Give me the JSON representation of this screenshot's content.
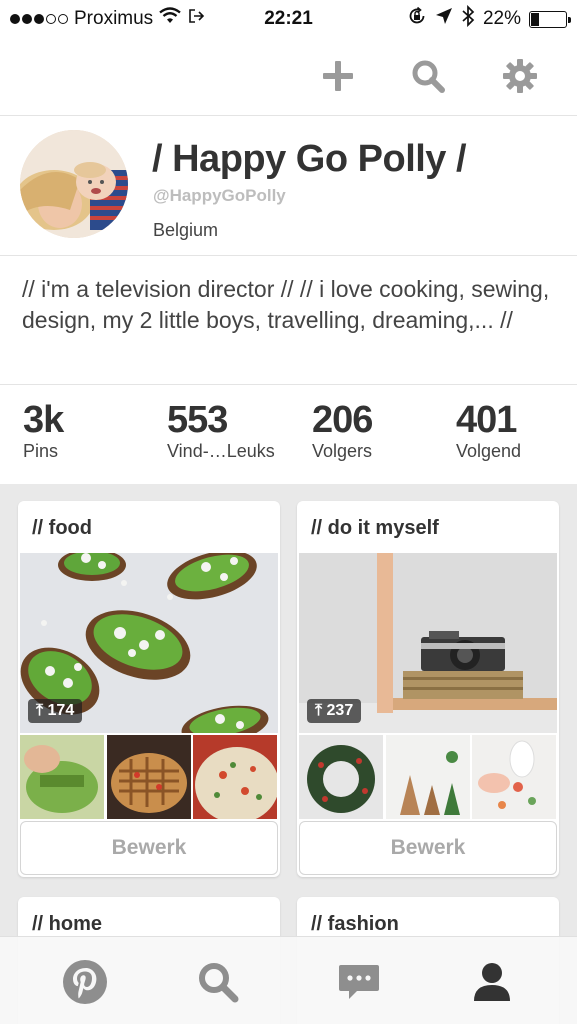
{
  "status_bar": {
    "carrier": "Proximus",
    "time": "22:21",
    "battery_percent": "22%",
    "battery_level": 0.22,
    "signal_bars_filled": 3,
    "signal_bars_total": 5,
    "icons": [
      "signal-dots-icon",
      "wifi-icon",
      "back-to-app-icon",
      "rotation-lock-icon",
      "location-arrow-icon",
      "bluetooth-icon",
      "battery-icon"
    ]
  },
  "actions": {
    "icons": [
      "add-icon",
      "search-icon",
      "settings-gear-icon"
    ]
  },
  "profile": {
    "name": "/ Happy Go Polly /",
    "handle": "@HappyGoPolly",
    "location": "Belgium",
    "bio": "// i'm a television director //  // i love cooking, sewing, design, my 2 little boys, travelling, dreaming,... //"
  },
  "stats": [
    {
      "value": "3k",
      "label": "Pins"
    },
    {
      "value": "553",
      "label": "Vind-…Leuks"
    },
    {
      "value": "206",
      "label": "Volgers"
    },
    {
      "value": "401",
      "label": "Volgend"
    }
  ],
  "boards": [
    {
      "title": "// food",
      "pin_count": "174",
      "edit_label": "Bewerk"
    },
    {
      "title": "// do it myself",
      "pin_count": "237",
      "edit_label": "Bewerk"
    },
    {
      "title": "// home"
    },
    {
      "title": "// fashion"
    }
  ],
  "tabbar": {
    "icons": [
      "pinterest-logo-icon",
      "search-icon",
      "messages-icon",
      "profile-icon"
    ]
  },
  "colors": {
    "text": "#333333",
    "muted": "#bdbdbd",
    "icon_gray": "#8e8e8e",
    "board_bg": "#e9e9e9"
  }
}
